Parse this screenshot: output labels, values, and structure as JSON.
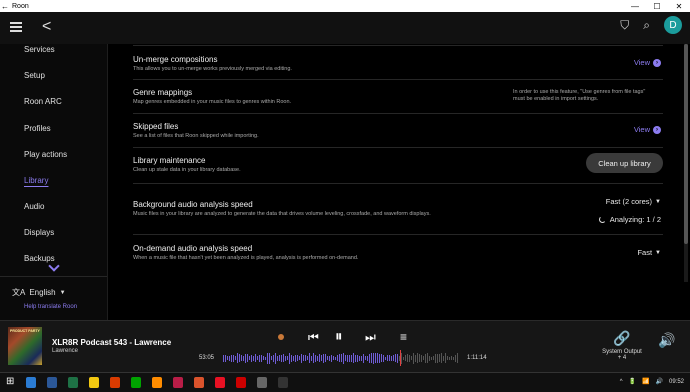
{
  "window": {
    "title": "Roon",
    "back_glyph": "←",
    "minimize": "—",
    "maximize": "☐",
    "close": "✕"
  },
  "header": {
    "menu_icon": "hamburger-icon",
    "back_icon": "back-chevron-icon",
    "back_glyph": "<",
    "bookmark_glyph": "⛉",
    "search_glyph": "⌕",
    "avatar_letter": "D",
    "avatar_color": "#1b9c9c"
  },
  "sidebar": {
    "items": [
      {
        "label": "Services"
      },
      {
        "label": "Setup"
      },
      {
        "label": "Roon ARC"
      },
      {
        "label": "Profiles"
      },
      {
        "label": "Play actions"
      },
      {
        "label": "Library",
        "active": true
      },
      {
        "label": "Audio"
      },
      {
        "label": "Displays"
      },
      {
        "label": "Backups"
      }
    ],
    "language": {
      "label": "English",
      "icon": "translate-icon",
      "glyph": "文A",
      "caret": "▼"
    },
    "help_translate": "Help translate Roon",
    "accent_color": "#8c7cf0"
  },
  "settings": {
    "unmerge": {
      "title": "Un-merge compositions",
      "desc": "This allows you to un-merge works previously merged via editing.",
      "action": "View",
      "action_glyph": "›"
    },
    "genre": {
      "title": "Genre mappings",
      "desc": "Map genres embedded in your music files to genres within Roon.",
      "note": "In order to use this feature, \"Use genres from file tags\" must be enabled in import settings."
    },
    "skipped": {
      "title": "Skipped files",
      "desc": "See a list of files that Roon skipped while importing.",
      "action": "View",
      "action_glyph": "›"
    },
    "maintenance": {
      "title": "Library maintenance",
      "desc": "Clean up stale data in your library database.",
      "action": "Clean up library"
    },
    "background": {
      "title": "Background audio analysis speed",
      "desc": "Music files in your library are analyzed to generate the data that drives volume leveling, crossfade, and waveform displays.",
      "value": "Fast (2 cores)",
      "caret": "▼",
      "status": "Analyzing: 1 / 2"
    },
    "ondemand": {
      "title": "On-demand audio analysis speed",
      "desc": "When a music file that hasn't yet been analyzed is played, analysis is performed on-demand.",
      "value": "Fast",
      "caret": "▼"
    }
  },
  "player": {
    "track_title": "XLR8R Podcast 543 - Lawrence",
    "artist": "Lawrence",
    "cover_text": "PRODUCT PARTY",
    "elapsed": "53:05",
    "duration": "1:11:14",
    "progress": 0.745,
    "prev_glyph": "⏮",
    "pause_glyph": "⏸",
    "next_glyph": "⏭",
    "queue_glyph": "≡",
    "output_glyph": "🔗",
    "volume_glyph": "🔊",
    "output_label": "System Output",
    "output_count": "+ 4"
  },
  "taskbar": {
    "time": "09:52",
    "tray_glyphs": [
      "^",
      "🔋",
      "📶",
      "🔊"
    ],
    "start_glyph": "⊞",
    "icon_colors": [
      "#2b7cd3",
      "#2b5797",
      "#1e7145",
      "#f2c811",
      "#d83b01",
      "#00a300",
      "#ff8c00",
      "#b91d47",
      "#da532c",
      "#e81123",
      "#cc0000",
      "#666666",
      "#333333"
    ]
  }
}
